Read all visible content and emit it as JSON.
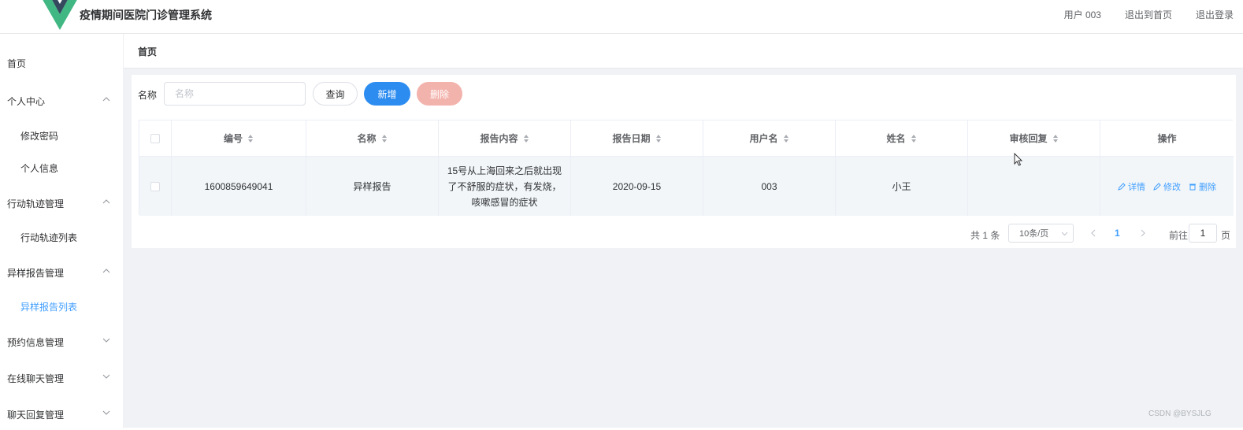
{
  "header": {
    "app_title": "疫情期间医院门诊管理系统",
    "user_label": "用户 003",
    "back_home": "退出到首页",
    "logout": "退出登录",
    "logo_colors": {
      "outer": "#41b883",
      "inner": "#35495e"
    }
  },
  "sidebar": {
    "items": [
      {
        "label": "首页",
        "type": "top"
      },
      {
        "label": "个人中心",
        "type": "group",
        "expanded": true
      },
      {
        "label": "修改密码",
        "type": "sub"
      },
      {
        "label": "个人信息",
        "type": "sub"
      },
      {
        "label": "行动轨迹管理",
        "type": "group",
        "expanded": true
      },
      {
        "label": "行动轨迹列表",
        "type": "sub"
      },
      {
        "label": "异样报告管理",
        "type": "group",
        "expanded": true
      },
      {
        "label": "异样报告列表",
        "type": "sub",
        "active": true
      },
      {
        "label": "预约信息管理",
        "type": "group",
        "expanded": false
      },
      {
        "label": "在线聊天管理",
        "type": "group",
        "expanded": false
      },
      {
        "label": "聊天回复管理",
        "type": "group",
        "expanded": false
      }
    ]
  },
  "breadcrumb": "首页",
  "search": {
    "label": "名称",
    "placeholder": "名称",
    "value": "",
    "query_button": "查询",
    "add_button": "新增",
    "delete_button": "删除"
  },
  "table": {
    "headers": [
      "编号",
      "名称",
      "报告内容",
      "报告日期",
      "用户名",
      "姓名",
      "审核回复",
      "操作"
    ],
    "rows": [
      {
        "id": "1600859649041",
        "name": "异样报告",
        "content": "15号从上海回来之后就出现了不舒服的症状，有发烧，咳嗽感冒的症状",
        "date": "2020-09-15",
        "username": "003",
        "realname": "小王",
        "reply": "",
        "actions": {
          "detail": "详情",
          "edit": "修改",
          "delete": "删除"
        }
      }
    ]
  },
  "pagination": {
    "total": "共 1 条",
    "page_size": "10条/页",
    "current_page": "1",
    "goto_label": "前往",
    "goto_value": "1",
    "page_suffix": "页"
  },
  "watermark": "CSDN @BYSJLG",
  "colors": {
    "primary": "#2d8cf0",
    "link": "#409eff",
    "danger_light": "#f3b3ad",
    "row_bg": "#f2f6f9",
    "page_bg": "#f0f2f5"
  }
}
